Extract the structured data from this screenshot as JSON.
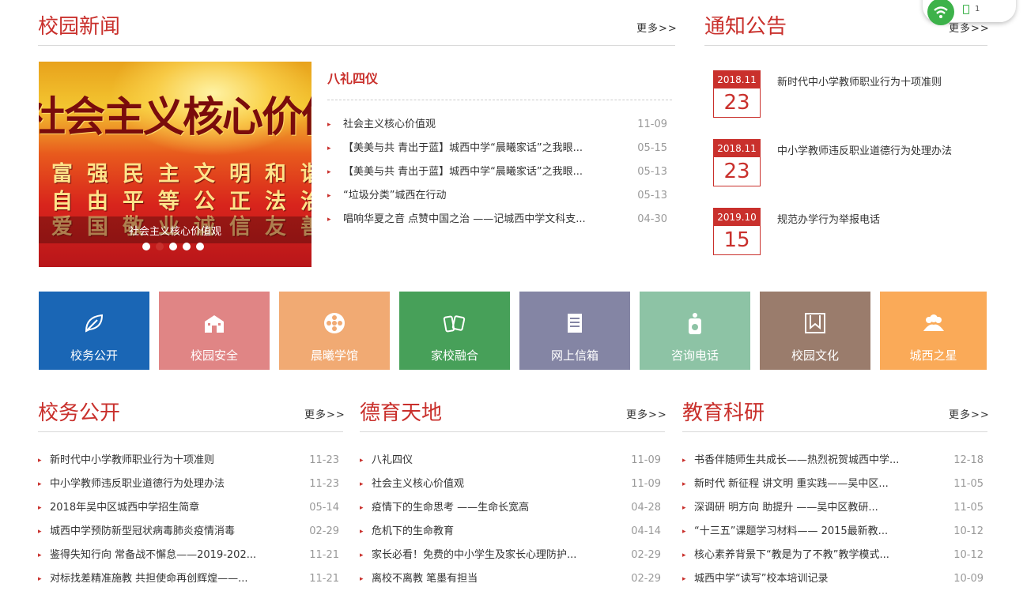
{
  "news": {
    "title": "校园新闻",
    "more": "更多>>",
    "slider": {
      "big_text": "社会主义核心价值",
      "row1": "富强民主文明和谐",
      "row2": "自由平等公正法治",
      "row3": "爱国敬业诚信友善",
      "caption": "社会主义核心价值观",
      "active_dot": 2,
      "dot_count": 5
    },
    "headline": "八礼四仪",
    "items": [
      {
        "title": "社会主义核心价值观",
        "date": "11-09"
      },
      {
        "title": "【美美与共 青出于蓝】城西中学“晨曦家话”之我眼...",
        "date": "05-15"
      },
      {
        "title": "【美美与共 青出于蓝】城西中学“晨曦家话”之我眼...",
        "date": "05-13"
      },
      {
        "title": "“垃圾分类”城西在行动",
        "date": "05-13"
      },
      {
        "title": "唱响华夏之音 点赞中国之治 ——记城西中学文科支...",
        "date": "04-30"
      }
    ]
  },
  "notice": {
    "title": "通知公告",
    "more": "更多>>",
    "items": [
      {
        "ym": "2018.11",
        "day": "23",
        "title": "新时代中小学教师职业行为十项准则"
      },
      {
        "ym": "2018.11",
        "day": "23",
        "title": "中小学教师违反职业道德行为处理办法"
      },
      {
        "ym": "2019.10",
        "day": "15",
        "title": "规范办学行为举报电话"
      }
    ]
  },
  "widget": {
    "count": "1"
  },
  "tiles": [
    {
      "label": "校务公开",
      "icon": "leaf-icon",
      "color": "#1a66b5"
    },
    {
      "label": "校园安全",
      "icon": "school-building-icon",
      "color": "#e08585"
    },
    {
      "label": "晨曦学馆",
      "icon": "flower-icon",
      "color": "#f1aa73"
    },
    {
      "label": "家校融合",
      "icon": "books-icon",
      "color": "#47a059"
    },
    {
      "label": "网上信箱",
      "icon": "document-icon",
      "color": "#8485a4"
    },
    {
      "label": "咨询电话",
      "icon": "phone-booth-icon",
      "color": "#8dc3a5"
    },
    {
      "label": "校园文化",
      "icon": "bookmark-frame-icon",
      "color": "#9a7c6c"
    },
    {
      "label": "城西之星",
      "icon": "people-group-icon",
      "color": "#faaa58"
    }
  ],
  "columns": [
    {
      "title": "校务公开",
      "more": "更多>>",
      "items": [
        {
          "title": "新时代中小学教师职业行为十项准则",
          "date": "11-23"
        },
        {
          "title": "中小学教师违反职业道德行为处理办法",
          "date": "11-23"
        },
        {
          "title": "2018年吴中区城西中学招生简章",
          "date": "05-14"
        },
        {
          "title": "城西中学预防新型冠状病毒肺炎疫情消毒",
          "date": "02-29"
        },
        {
          "title": "鉴得失知行向 常备战不懈怠——2019-202...",
          "date": "11-21"
        },
        {
          "title": "对标找差精准施教 共担使命再创辉煌——...",
          "date": "11-21"
        }
      ]
    },
    {
      "title": "德育天地",
      "more": "更多>>",
      "items": [
        {
          "title": "八礼四仪",
          "date": "11-09"
        },
        {
          "title": "社会主义核心价值观",
          "date": "11-09"
        },
        {
          "title": "疫情下的生命思考 ——生命长宽高",
          "date": "04-28"
        },
        {
          "title": "危机下的生命教育",
          "date": "04-14"
        },
        {
          "title": "家长必看！免费的中小学生及家长心理防护...",
          "date": "02-29"
        },
        {
          "title": "离校不离教 笔墨有担当",
          "date": "02-29"
        }
      ]
    },
    {
      "title": "教育科研",
      "more": "更多>>",
      "items": [
        {
          "title": "书香伴随师生共成长——热烈祝贺城西中学...",
          "date": "12-18"
        },
        {
          "title": "新时代 新征程 讲文明 重实践——吴中区...",
          "date": "11-05"
        },
        {
          "title": "深调研 明方向 助提升 ——吴中区教研...",
          "date": "11-05"
        },
        {
          "title": "“十三五”课题学习材料—— 2015最新教...",
          "date": "10-12"
        },
        {
          "title": "核心素养背景下“教是为了不教”教学模式...",
          "date": "10-12"
        },
        {
          "title": "城西中学“读写”校本培训记录",
          "date": "10-09"
        }
      ]
    }
  ]
}
